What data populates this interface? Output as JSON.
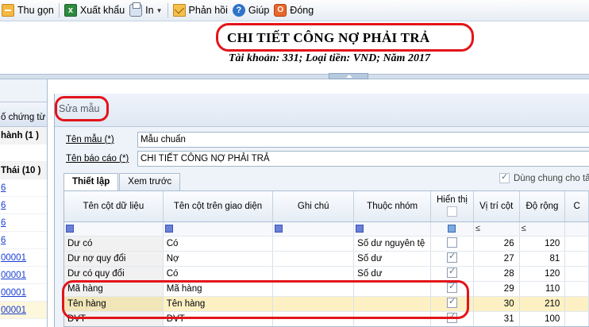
{
  "toolbar": {
    "collapse": "Thu gọn",
    "export_excel": "Xuất khẩu",
    "print": "In",
    "feedback": "Phản hồi",
    "help": "Giúp",
    "close": "Đóng"
  },
  "report": {
    "title": "CHI TIẾT CÔNG NỢ PHẢI TRẢ",
    "subtitle": "Tài khoản: 331; Loại tiền: VND; Năm 2017"
  },
  "left_list": {
    "header": "ố chứng từ",
    "rows": [
      {
        "text": "hành (1 )",
        "kind": "group"
      },
      {
        "text": "",
        "kind": "blank"
      },
      {
        "text": "Thái (10 )",
        "kind": "group"
      },
      {
        "text": "6",
        "kind": "link"
      },
      {
        "text": "6",
        "kind": "link"
      },
      {
        "text": "6",
        "kind": "link"
      },
      {
        "text": "6",
        "kind": "link"
      },
      {
        "text": "00001",
        "kind": "link"
      },
      {
        "text": "00001",
        "kind": "link"
      },
      {
        "text": "00001",
        "kind": "link"
      },
      {
        "text": "00001",
        "kind": "link-alt"
      }
    ]
  },
  "dialog": {
    "title": "Sửa mẫu",
    "template_name_label": "Tên mẫu (*)",
    "template_name_value": "Mẫu chuẩn",
    "report_name_label": "Tên báo cáo (*)",
    "report_name_value": "CHI TIẾT CÔNG NỢ PHẢI TRẢ",
    "shared_label": "Dùng chung cho tấ",
    "tabs": [
      "Thiết lập",
      "Xem trước"
    ]
  },
  "grid": {
    "columns": [
      "Tên cột dữ liệu",
      "Tên cột trên giao diện",
      "Ghi chú",
      "Thuộc nhóm",
      "Hiển thị",
      "Vị trí cột",
      "Độ rộng",
      "C"
    ],
    "filter_ops": {
      "position": "≤",
      "width": "≤"
    },
    "rows": [
      {
        "data_col": "Dư có",
        "display_name": "Có",
        "note": "",
        "group": "Số dư nguyên tệ",
        "visible": false,
        "position": "26",
        "width": "120",
        "highlight": false
      },
      {
        "data_col": "Dư nợ quy đổi",
        "display_name": "Nợ",
        "note": "",
        "group": "Số dư",
        "visible": true,
        "position": "27",
        "width": "81",
        "highlight": false
      },
      {
        "data_col": "Dư có quy đổi",
        "display_name": "Có",
        "note": "",
        "group": "Số dư",
        "visible": true,
        "position": "28",
        "width": "120",
        "highlight": false
      },
      {
        "data_col": "Mã hàng",
        "display_name": "Mã hàng",
        "note": "",
        "group": "",
        "visible": true,
        "position": "29",
        "width": "110",
        "highlight": false
      },
      {
        "data_col": "Tên hàng",
        "display_name": "Tên hàng",
        "note": "",
        "group": "",
        "visible": true,
        "position": "30",
        "width": "210",
        "highlight": true
      },
      {
        "data_col": "ĐVT",
        "display_name": "ĐVT",
        "note": "",
        "group": "",
        "visible": true,
        "position": "31",
        "width": "100",
        "highlight": false
      }
    ]
  }
}
